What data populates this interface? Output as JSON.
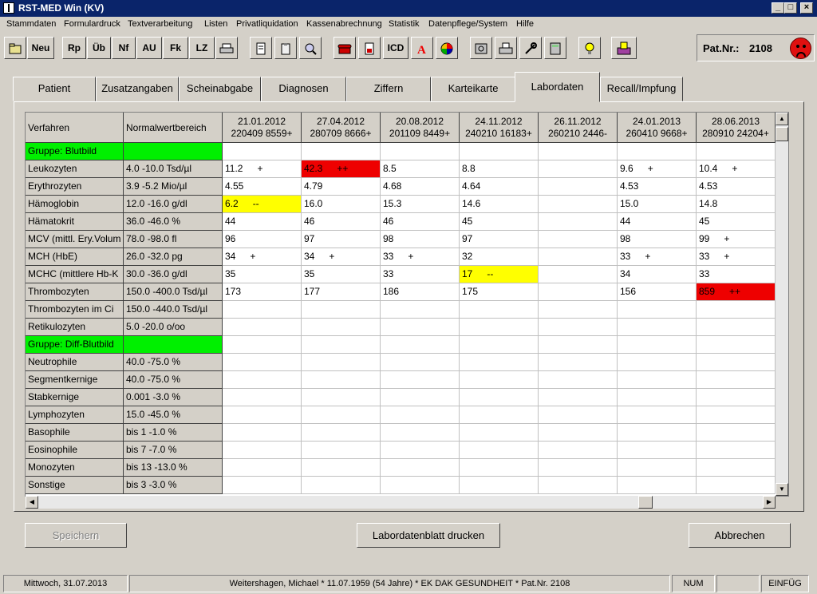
{
  "window": {
    "title": "RST-MED Win (KV)"
  },
  "menu": [
    "Stammdaten",
    "Formulardruck",
    "Textverarbeitung",
    "Listen",
    "Privatliquidation",
    "Kassenabrechnung",
    "Statistik",
    "Datenpflege/System",
    "Hilfe"
  ],
  "toolbar": {
    "text_buttons": [
      "Neu",
      "Rp",
      "Üb",
      "Nf",
      "AU",
      "Fk",
      "LZ",
      "ICD"
    ]
  },
  "patient": {
    "label": "Pat.Nr.:",
    "number": "2108"
  },
  "tabs": [
    "Patient",
    "Zusatzangaben",
    "Scheinabgabe",
    "Diagnosen",
    "Ziffern",
    "Karteikarte",
    "Labordaten",
    "Recall/Impfung"
  ],
  "grid": {
    "col_verfahren": "Verfahren",
    "col_normal": "Normalwertbereich",
    "dates": [
      {
        "date": "21.01.2012",
        "code": "220409  8559+"
      },
      {
        "date": "27.04.2012",
        "code": "280709  8666+"
      },
      {
        "date": "20.08.2012",
        "code": "201109  8449+"
      },
      {
        "date": "24.11.2012",
        "code": "240210 16183+"
      },
      {
        "date": "26.11.2012",
        "code": "260210  2446-"
      },
      {
        "date": "24.01.2013",
        "code": "260410  9668+"
      },
      {
        "date": "28.06.2013",
        "code": "280910 24204+"
      }
    ],
    "rows": [
      {
        "name": "Gruppe: Blutbild",
        "range": "",
        "group": true,
        "values": []
      },
      {
        "name": "Leukozyten",
        "range": "4.0   -10.0 Tsd/µl",
        "values": [
          {
            "v": "11.2",
            "f": "+"
          },
          {
            "v": "42.3",
            "f": "++",
            "c": "red"
          },
          {
            "v": "8.5"
          },
          {
            "v": "8.8"
          },
          {
            "v": ""
          },
          {
            "v": "9.6",
            "f": "+"
          },
          {
            "v": "10.4",
            "f": "+"
          }
        ]
      },
      {
        "name": "Erythrozyten",
        "range": "3.9   -5.2 Mio/µl",
        "values": [
          {
            "v": "4.55"
          },
          {
            "v": "4.79"
          },
          {
            "v": "4.68"
          },
          {
            "v": "4.64"
          },
          {
            "v": ""
          },
          {
            "v": "4.53"
          },
          {
            "v": "4.53"
          }
        ]
      },
      {
        "name": "Hämoglobin",
        "range": "12.0  -16.0 g/dl",
        "values": [
          {
            "v": "6.2",
            "f": "--",
            "c": "yel"
          },
          {
            "v": "16.0"
          },
          {
            "v": "15.3"
          },
          {
            "v": "14.6"
          },
          {
            "v": ""
          },
          {
            "v": "15.0"
          },
          {
            "v": "14.8"
          }
        ]
      },
      {
        "name": "Hämatokrit",
        "range": "36.0  -46.0 %",
        "values": [
          {
            "v": "44"
          },
          {
            "v": "46"
          },
          {
            "v": "46"
          },
          {
            "v": "45"
          },
          {
            "v": ""
          },
          {
            "v": "44"
          },
          {
            "v": "45"
          }
        ]
      },
      {
        "name": "MCV (mittl. Ery.Volum",
        "range": "78.0  -98.0 fl",
        "values": [
          {
            "v": "96"
          },
          {
            "v": "97"
          },
          {
            "v": "98"
          },
          {
            "v": "97"
          },
          {
            "v": ""
          },
          {
            "v": "98"
          },
          {
            "v": "99",
            "f": "+"
          }
        ]
      },
      {
        "name": "MCH (HbE)",
        "range": "26.0  -32.0 pg",
        "values": [
          {
            "v": "34",
            "f": "+"
          },
          {
            "v": "34",
            "f": "+"
          },
          {
            "v": "33",
            "f": "+"
          },
          {
            "v": "32"
          },
          {
            "v": ""
          },
          {
            "v": "33",
            "f": "+"
          },
          {
            "v": "33",
            "f": "+"
          }
        ]
      },
      {
        "name": "MCHC (mittlere Hb-K",
        "range": "30.0  -36.0 g/dl",
        "values": [
          {
            "v": "35"
          },
          {
            "v": "35"
          },
          {
            "v": "33"
          },
          {
            "v": "17",
            "f": "--",
            "c": "yel"
          },
          {
            "v": ""
          },
          {
            "v": "34"
          },
          {
            "v": "33"
          }
        ]
      },
      {
        "name": "Thrombozyten",
        "range": "150.0  -400.0 Tsd/µl",
        "values": [
          {
            "v": "173"
          },
          {
            "v": "177"
          },
          {
            "v": "186"
          },
          {
            "v": "175"
          },
          {
            "v": ""
          },
          {
            "v": "156"
          },
          {
            "v": "859",
            "f": "++",
            "c": "red"
          }
        ]
      },
      {
        "name": "Thrombozyten im Ci",
        "range": "150.0  -440.0 Tsd/µl",
        "values": []
      },
      {
        "name": "Retikulozyten",
        "range": "5.0   -20.0 o/oo",
        "values": []
      },
      {
        "name": "Gruppe: Diff-Blutbild",
        "range": "",
        "group": true,
        "values": []
      },
      {
        "name": "Neutrophile",
        "range": "40.0  -75.0 %",
        "values": []
      },
      {
        "name": "Segmentkernige",
        "range": "40.0  -75.0 %",
        "values": []
      },
      {
        "name": "Stabkernige",
        "range": "0.001  -3.0 %",
        "values": []
      },
      {
        "name": "Lymphozyten",
        "range": "15.0  -45.0 %",
        "values": []
      },
      {
        "name": "Basophile",
        "range": "bis 1  -1.0 %",
        "values": []
      },
      {
        "name": "Eosinophile",
        "range": "bis 7  -7.0 %",
        "values": []
      },
      {
        "name": "Monozyten",
        "range": "bis 13 -13.0 %",
        "values": []
      },
      {
        "name": "Sonstige",
        "range": "bis 3  -3.0 %",
        "values": []
      }
    ]
  },
  "buttons": {
    "save": "Speichern",
    "print": "Labordatenblatt drucken",
    "cancel": "Abbrechen"
  },
  "status": {
    "date": "Mittwoch, 31.07.2013",
    "patient": "Weitershagen, Michael * 11.07.1959 (54 Jahre)  *  EK DAK GESUNDHEIT  *  Pat.Nr. 2108",
    "num": "NUM",
    "mode": "EINFÜG"
  },
  "colors": {
    "group": "#00f000",
    "high": "#ee0000",
    "low": "#ffff00",
    "titlebar": "#0a246a"
  }
}
